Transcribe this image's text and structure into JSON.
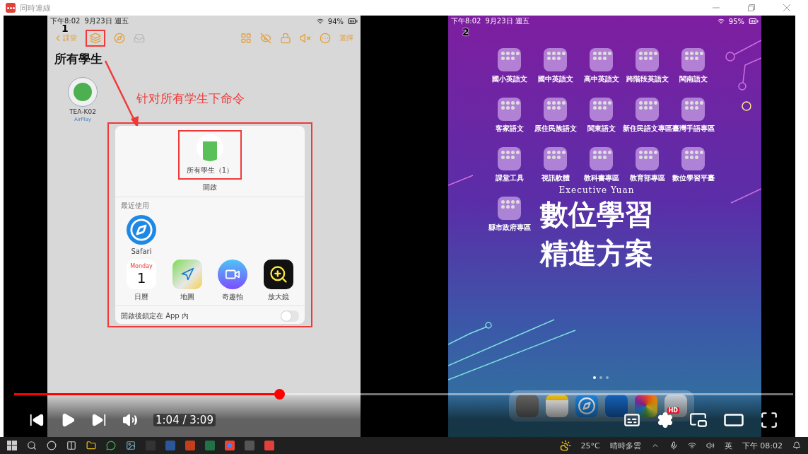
{
  "window": {
    "title": "同時連線"
  },
  "left_screen": {
    "label": "1",
    "status_bar": {
      "time": "下午8:02",
      "date": "9月23日 週五",
      "battery": "94%"
    },
    "toolbar": {
      "back": "課堂",
      "action": "選擇"
    },
    "title": "所有學生",
    "student": {
      "name": "TEA-K02",
      "status": "AirPlay"
    },
    "annotation": "针对所有学生下命令",
    "popover": {
      "group": "所有學生（1）",
      "open": "開啟",
      "recent_heading": "最近使用",
      "recent_apps": [
        {
          "name": "Safari",
          "kind": "safari"
        }
      ],
      "apps": [
        {
          "name": "日曆",
          "kind": "calendar",
          "day": "Monday",
          "date": "1"
        },
        {
          "name": "地圖",
          "kind": "maps"
        },
        {
          "name": "奇趣拍",
          "kind": "clips"
        },
        {
          "name": "放大鏡",
          "kind": "magnifier"
        }
      ],
      "lock_label": "開啟後鎖定在 App 內",
      "lock_on": false
    }
  },
  "right_screen": {
    "label": "2",
    "status_bar": {
      "time": "下午8:02",
      "date": "9月23日 週五",
      "battery": "95%"
    },
    "folders": [
      "國小英語文",
      "國中英語文",
      "高中英語文",
      "跨階段英語文",
      "閩南語文",
      "客家語文",
      "原住民族語文",
      "閩東語文",
      "新住民語文專區",
      "臺灣手語專區",
      "課堂工具",
      "視訊軟體",
      "教科書專區",
      "教育部專區",
      "數位學習平臺",
      "縣市政府專區"
    ],
    "wallpaper": {
      "subtitle": "Executive Yuan",
      "headline": [
        "數位學習",
        "精進方案"
      ]
    },
    "page_dots": [
      {
        "selected": true
      },
      {
        "selected": false
      },
      {
        "selected": false
      }
    ],
    "dock": [
      {
        "kind": "cloud"
      },
      {
        "kind": "notes"
      },
      {
        "kind": "safari"
      },
      {
        "kind": "keynote"
      },
      {
        "kind": "photos"
      },
      {
        "kind": "folder"
      }
    ]
  },
  "player": {
    "progress": {
      "level": 0.34
    },
    "time": "1:04 / 3:09",
    "quality_badge": "HD"
  },
  "taskbar": {
    "temperature": "25°C",
    "weather": "晴時多雲",
    "input_method": "英",
    "clock": "下午 08:02"
  }
}
